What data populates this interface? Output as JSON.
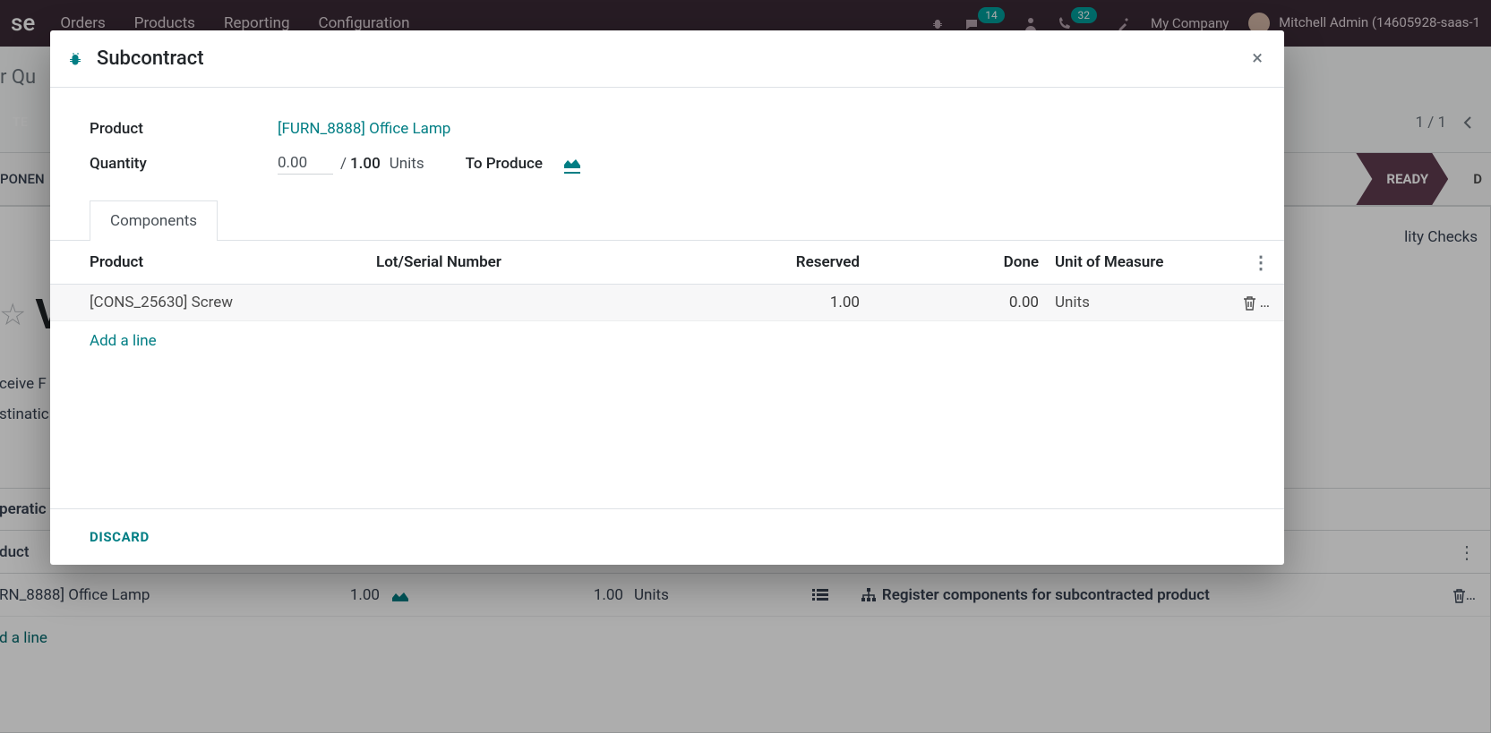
{
  "topbar": {
    "brand_fragment": "se",
    "menu": [
      "Orders",
      "Products",
      "Reporting",
      "Configuration"
    ],
    "badge1": "14",
    "badge2": "32",
    "company": "My Company",
    "user": "Mitchell Admin (14605928-saas-1"
  },
  "breadcrumb_fragment": "r Qu",
  "create_btn_fragment": "TE",
  "pager": "1 / 1",
  "statusbar": {
    "left_fragment": "PONEN",
    "ready": "READY",
    "d": "D"
  },
  "bgform": {
    "quality_checks_fragment": "lity Checks",
    "title_char": "V",
    "receive_fragment": "ceive F",
    "destination_fragment": "stinatic",
    "operations_fragment": "peratic",
    "product_header_fragment": "duct",
    "row": {
      "product_fragment": "RN_8888] Office Lamp",
      "demand": "1.00",
      "done": "1.00",
      "uom": "Units",
      "register": "Register components for subcontracted product"
    },
    "add_line_fragment": "d a line"
  },
  "modal": {
    "title": "Subcontract",
    "product_label": "Product",
    "product_value": "[FURN_8888] Office Lamp",
    "quantity_label": "Quantity",
    "qty_value": "0.00",
    "qty_total": "1.00",
    "units": "Units",
    "to_produce": "To Produce",
    "tab_components": "Components",
    "headers": {
      "product": "Product",
      "lot": "Lot/Serial Number",
      "reserved": "Reserved",
      "done": "Done",
      "uom": "Unit of Measure"
    },
    "rows": [
      {
        "product": "[CONS_25630] Screw",
        "lot": "",
        "reserved": "1.00",
        "done": "0.00",
        "uom": "Units"
      }
    ],
    "add_line": "Add a line",
    "discard": "DISCARD"
  }
}
